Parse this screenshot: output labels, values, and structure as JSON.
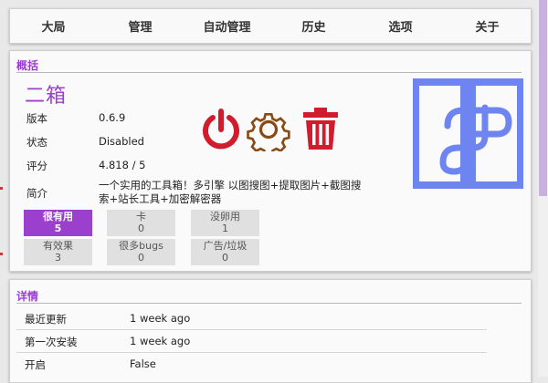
{
  "colors": {
    "accent": "#9b3fcf",
    "danger": "#d01c2c",
    "gear": "#8a4a14",
    "logo_blue": "#6e84f0"
  },
  "nav": {
    "tabs": [
      "大局",
      "管理",
      "自动管理",
      "历史",
      "选项",
      "关于"
    ]
  },
  "overview": {
    "section_title": "概括",
    "app_name": "二箱",
    "fields": [
      {
        "label": "版本",
        "value": "0.6.9"
      },
      {
        "label": "状态",
        "value": "Disabled"
      },
      {
        "label": "评分",
        "value": "4.818 / 5"
      }
    ],
    "description_label": "简介",
    "description": "一个实用的工具箱！多引擎 以图搜图+提取图片+截图搜索+站长工具+加密解密器",
    "icons": [
      "power-icon",
      "gear-icon",
      "trash-icon"
    ]
  },
  "ratings": [
    {
      "label": "很有用",
      "count": "5",
      "active": true
    },
    {
      "label": "卡",
      "count": "0",
      "active": false
    },
    {
      "label": "没卵用",
      "count": "1",
      "active": false
    },
    {
      "label": "有效果",
      "count": "3",
      "active": false
    },
    {
      "label": "很多bugs",
      "count": "0",
      "active": false
    },
    {
      "label": "广告/垃圾",
      "count": "0",
      "active": false
    }
  ],
  "details": {
    "section_title": "详情",
    "rows": [
      {
        "label": "最近更新",
        "value": "1 week ago"
      },
      {
        "label": "第一次安装",
        "value": "1 week ago"
      },
      {
        "label": "开启",
        "value": "False"
      }
    ]
  }
}
